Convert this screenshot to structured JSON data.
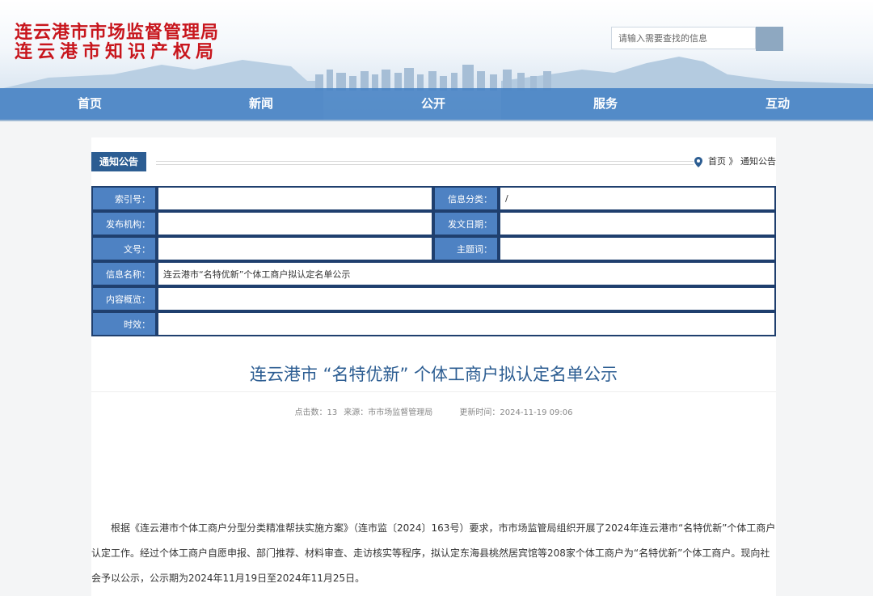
{
  "site": {
    "name_line1": "连云港市市场监督管理局",
    "name_line2": "连云港市知识产权局"
  },
  "search": {
    "placeholder": "请输入需要查找的信息"
  },
  "nav": [
    {
      "label": "首页"
    },
    {
      "label": "新闻"
    },
    {
      "label": "公开"
    },
    {
      "label": "服务"
    },
    {
      "label": "互动"
    }
  ],
  "section_tag": "通知公告",
  "breadcrumb": {
    "home": "首页",
    "separator": "》",
    "current": "通知公告"
  },
  "meta": {
    "index_no_label": "索引号：",
    "index_no_value": "",
    "category_label": "信息分类：",
    "category_value": "/",
    "publisher_label": "发布机构：",
    "publisher_value": "",
    "date_label": "发文日期：",
    "date_value": "",
    "doc_no_label": "文号：",
    "doc_no_value": "",
    "subject_label": "主题词：",
    "subject_value": "",
    "name_label": "信息名称：",
    "name_value": "连云港市“名特优新”个体工商户拟认定名单公示",
    "summary_label": "内容概览：",
    "summary_value": "",
    "validity_label": "时效：",
    "validity_value": ""
  },
  "article": {
    "title": "连云港市 “名特优新” 个体工商户拟认定名单公示",
    "clicks": "点击数：13",
    "source": "来源：市市场监督管理局",
    "updated": "更新时间：2024-11-19 09:06",
    "paragraph": "根据《连云港市个体工商户分型分类精准帮扶实施方案》（连市监〔2024〕163号）要求，市市场监管局组织开展了2024年连云港市“名特优新”个体工商户认定工作。经过个体工商户自愿申报、部门推荐、材料审查、走访核实等程序，拟认定东海县桃然居宾馆等208家个体工商户为“名特优新”个体工商户。现向社会予以公示，公示期为2024年11月19日至2024年11月25日。"
  },
  "colors": {
    "brand_red": "#c8161d",
    "nav_blue": "#4682c4",
    "label_blue": "#4e82c3",
    "border_navy": "#1f3f6e",
    "title_blue": "#2c5d92"
  }
}
